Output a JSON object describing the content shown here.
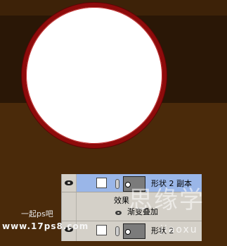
{
  "canvas": {
    "background": "#4a2a0a",
    "band_color": "#2a1706",
    "circle_fill": "#ffffff",
    "circle_stroke": "#8e0b0b"
  },
  "layers_panel": {
    "selected_color": "#9ab6e8",
    "rows": [
      {
        "name": "形状 2 副本",
        "selected": true,
        "visible": true,
        "eye_icon": "eye-icon"
      },
      {
        "name": "形状 2",
        "selected": false,
        "visible": true,
        "eye_icon": "eye-icon"
      }
    ],
    "effects_label": "效果",
    "effect_item": "渐变叠加"
  },
  "watermarks": {
    "line1": "一起ps吧",
    "line2": "www.17ps8.com",
    "big": "思缘学",
    "site": "jiaoxu"
  }
}
